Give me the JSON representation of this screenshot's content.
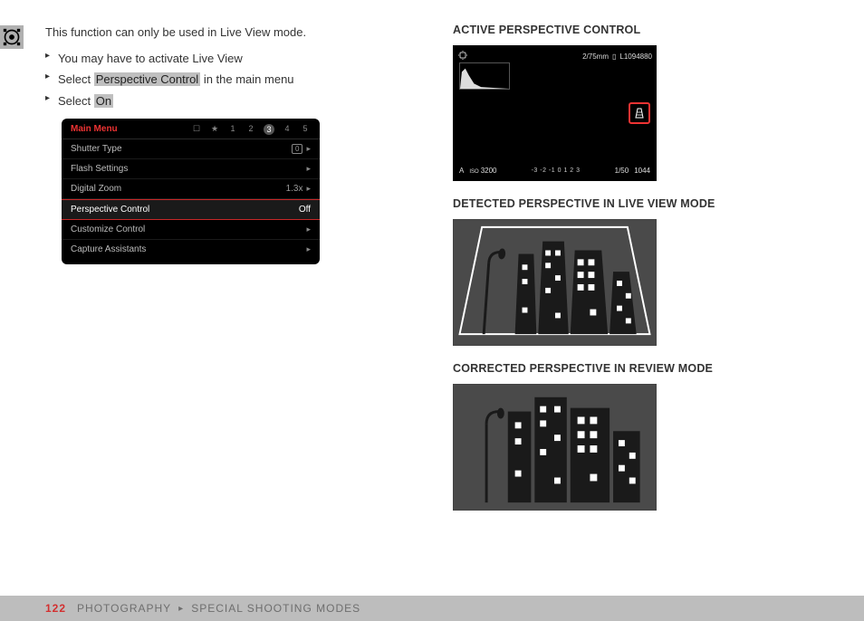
{
  "sidebar_icon": "camera-viewfinder",
  "left": {
    "intro": "This function can only be used in Live View mode.",
    "steps": {
      "s1": "You may have to activate Live View",
      "s2a": "Select ",
      "s2_hl": "Perspective Control",
      "s2b": " in the main menu",
      "s3a": "Select ",
      "s3_hl": "On"
    }
  },
  "menu": {
    "title": "Main Menu",
    "pages": [
      "1",
      "2",
      "3",
      "4",
      "5"
    ],
    "active_page": "3",
    "rows": [
      {
        "label": "Shutter Type",
        "value": "",
        "icon": "range"
      },
      {
        "label": "Flash Settings",
        "value": "",
        "icon": "chev"
      },
      {
        "label": "Digital Zoom",
        "value": "1.3x",
        "icon": "chev"
      },
      {
        "label": "Perspective Control",
        "value": "Off",
        "icon": "",
        "hl": true
      },
      {
        "label": "Customize Control",
        "value": "",
        "icon": "chev"
      },
      {
        "label": "Capture Assistants",
        "value": "",
        "icon": "chev"
      }
    ]
  },
  "right": {
    "h1": "ACTIVE PERSPECTIVE CONTROL",
    "h2": "DETECTED PERSPECTIVE IN LIVE VIEW MODE",
    "h3": "CORRECTED PERSPECTIVE IN REVIEW MODE"
  },
  "display": {
    "top_left_icon": "stabilizer",
    "top_right_a": "2/75mm",
    "top_right_b": "L1094880",
    "bot_mode": "A",
    "bot_iso_label": "ISO",
    "bot_iso": "3200",
    "bot_ev": "-3 -2 -1  0  1 2 3",
    "bot_shutter": "1/50",
    "bot_count": "1044"
  },
  "footer": {
    "page": "122",
    "a": "PHOTOGRAPHY",
    "b": "SPECIAL SHOOTING MODES"
  }
}
